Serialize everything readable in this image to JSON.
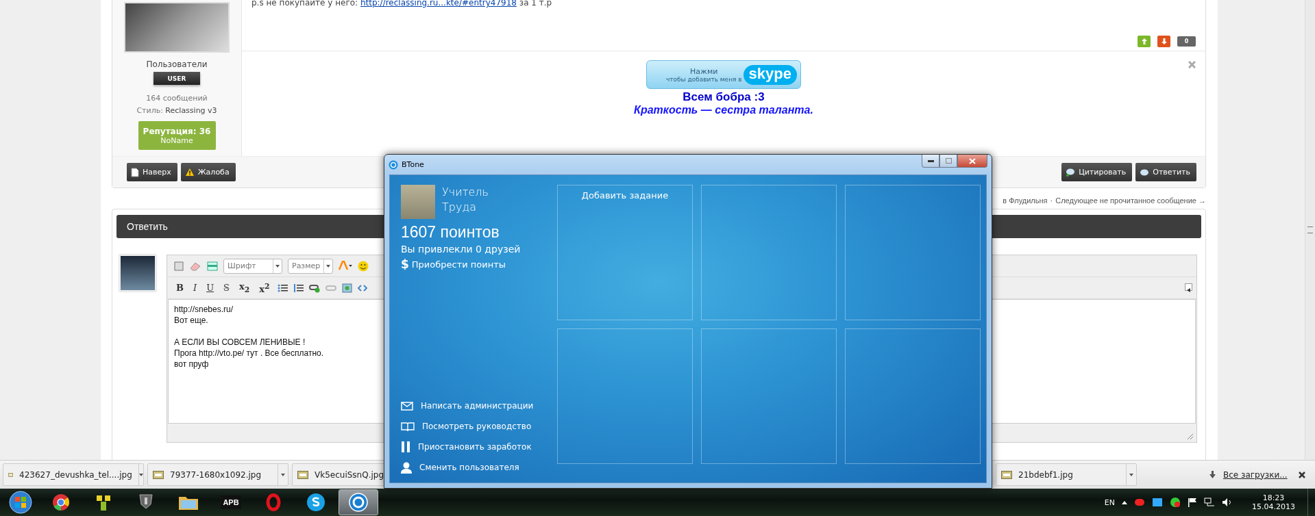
{
  "post": {
    "author": {
      "group": "Пользователи",
      "badge": "USER",
      "posts": "164 сообщений",
      "style_label": "Стиль:",
      "style_value": "Reclassing v3",
      "reputation": "Репутация: 36",
      "reputation_name": "NoName"
    },
    "message": {
      "before": "p.s не покупайте у него:",
      "link": "http://reclassing.ru...kte/#entry47918",
      "after": "за 1 т.р"
    },
    "score": "0",
    "signature": {
      "skype_top": "Нажми",
      "skype_bottom": "чтобы добавить меня в",
      "skype_logo": "skype",
      "greeting": "Всем бобра :3",
      "quote": "Краткость — сестра таланта."
    },
    "footer_left": [
      {
        "kind": "top",
        "label": "Наверх"
      },
      {
        "kind": "report",
        "label": "Жалоба"
      }
    ],
    "footer_right": [
      {
        "kind": "quote",
        "label": "Цитировать"
      },
      {
        "kind": "reply",
        "label": "Ответить"
      }
    ]
  },
  "nav": {
    "forum": "в Флудильня",
    "separator": "·",
    "next": "Следующее не прочитанное сообщение →"
  },
  "reply": {
    "title": "Ответить",
    "font": "Шрифт",
    "size": "Размер",
    "format_buttons": [
      {
        "kind": "bold",
        "label": "B"
      },
      {
        "kind": "italic",
        "label": "I"
      },
      {
        "kind": "underline",
        "label": "U"
      },
      {
        "kind": "strike",
        "label": "S"
      },
      {
        "kind": "script",
        "label": "x$_{2}$"
      },
      {
        "kind": "script",
        "label": "x$^{2}$"
      }
    ],
    "value": "http://snebes.ru/\nВот еще.\n\nА ЕСЛИ ВЫ СОВСЕМ ЛЕНИВЫЕ !\nПрога http://vto.pe/ тут . Все бесплатно.\nвот пруф"
  },
  "window": {
    "title": "BTone",
    "user_first": "Учитель",
    "user_last": "Труда",
    "points": "1607 поинтов",
    "friends": "Вы привлекли 0 друзей",
    "buy_icon": "$",
    "buy": "Приобрести поинты",
    "tiles": [
      {
        "kind": "add",
        "label": "Добавить задание"
      },
      {
        "kind": "empty"
      },
      {
        "kind": "empty"
      },
      {
        "kind": "empty"
      },
      {
        "kind": "empty"
      },
      {
        "kind": "empty"
      }
    ],
    "menu": [
      {
        "kind": "mail",
        "label": "Написать администрации"
      },
      {
        "kind": "book",
        "label": "Посмотреть руководство"
      },
      {
        "kind": "pause",
        "label": "Приостановить заработок"
      },
      {
        "kind": "user",
        "label": "Сменить пользователя"
      }
    ]
  },
  "downloads": {
    "items": [
      {
        "name": "423627_devushka_tel....jpg"
      },
      {
        "name": "79377-1680x1092.jpg"
      },
      {
        "name": "Vk5ecuiSsnQ.jpg"
      },
      {
        "name": "21bdebf1.jpg"
      }
    ],
    "all": "Все загрузки..."
  },
  "taskbar": {
    "apps": [
      {
        "kind": "chrome",
        "selected": false
      },
      {
        "kind": "qip",
        "selected": false
      },
      {
        "kind": "tank",
        "selected": false
      },
      {
        "kind": "folder",
        "selected": false
      },
      {
        "kind": "apb",
        "label": "APB",
        "selected": false
      },
      {
        "kind": "opera",
        "selected": false
      },
      {
        "kind": "skype",
        "selected": false
      },
      {
        "kind": "btone",
        "selected": true
      }
    ],
    "lang": "EN",
    "time": "18:23",
    "date": "15.04.2013"
  }
}
